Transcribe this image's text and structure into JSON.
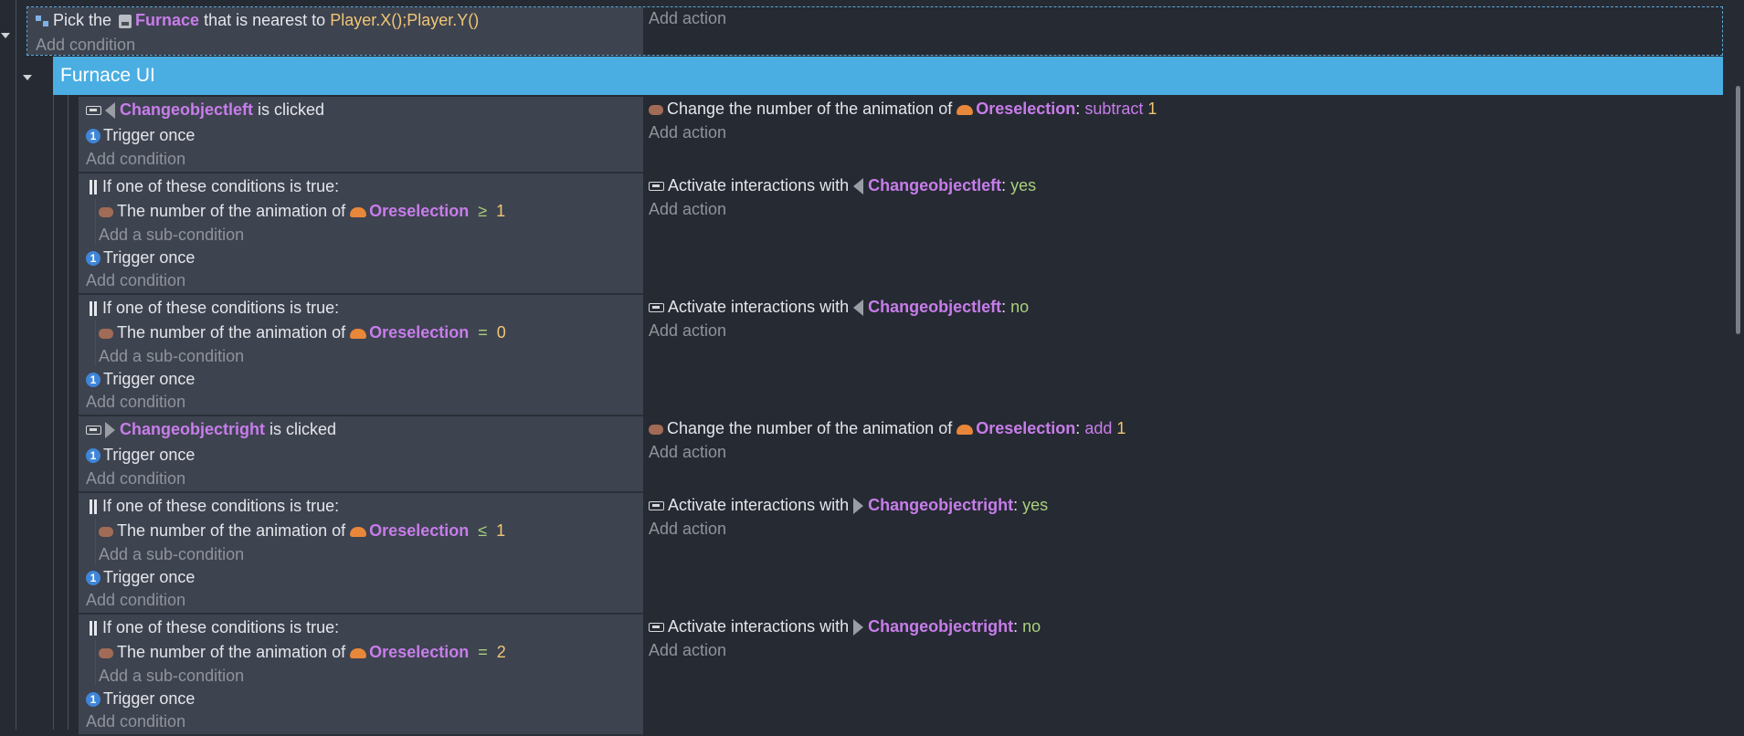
{
  "top_event": {
    "pick_prefix": "Pick the",
    "object": "Furnace",
    "middle_text": "that is nearest to",
    "expression": "Player.X();Player.Y()",
    "add_condition": "Add condition",
    "add_action": "Add action"
  },
  "group": {
    "title": "Furnace UI"
  },
  "labels": {
    "trigger_once": "Trigger once",
    "add_condition": "Add condition",
    "add_action": "Add action",
    "add_sub_condition": "Add a sub-condition",
    "or_header": "If one of these conditions is true:",
    "anim_number": "The number of the animation of",
    "is_clicked": "is clicked",
    "change_anim": "Change the number of the animation of",
    "activate_interactions": "Activate interactions with",
    "colon": ":"
  },
  "events": [
    {
      "type": "clicked",
      "object": "Changeobjectleft",
      "action": {
        "kind": "change",
        "object": "Oreselection",
        "op": "subtract",
        "value": "1"
      }
    },
    {
      "type": "or",
      "object": "Oreselection",
      "operator": "≥",
      "value": "1",
      "action": {
        "kind": "activate",
        "object": "Changeobjectleft",
        "value": "yes"
      }
    },
    {
      "type": "or",
      "object": "Oreselection",
      "operator": "=",
      "value": "0",
      "action": {
        "kind": "activate",
        "object": "Changeobjectleft",
        "value": "no"
      }
    },
    {
      "type": "clicked",
      "object": "Changeobjectright",
      "action": {
        "kind": "change",
        "object": "Oreselection",
        "op": "add",
        "value": "1"
      }
    },
    {
      "type": "or",
      "object": "Oreselection",
      "operator": "≤",
      "value": "1",
      "action": {
        "kind": "activate",
        "object": "Changeobjectright",
        "value": "yes"
      }
    },
    {
      "type": "or",
      "object": "Oreselection",
      "operator": "=",
      "value": "2",
      "action": {
        "kind": "activate",
        "object": "Changeobjectright",
        "value": "no"
      }
    }
  ],
  "colors": {
    "group_header": "#4aaee3",
    "object_name": "#c77dea",
    "expression": "#f0c674",
    "value_green": "#a8d17d",
    "condition_bg": "#3e4350",
    "background": "#262a33"
  }
}
